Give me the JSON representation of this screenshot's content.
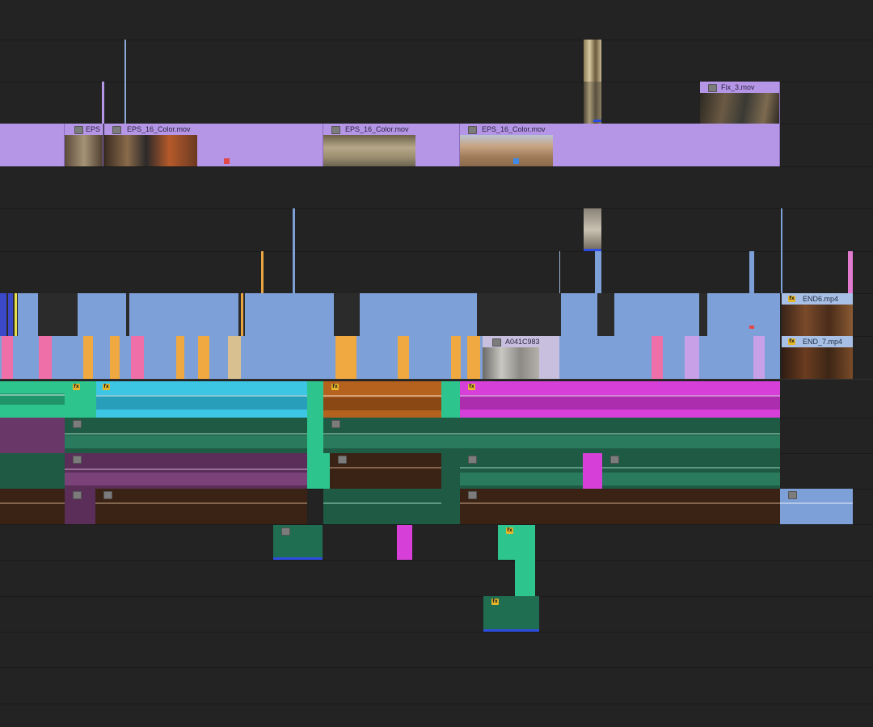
{
  "colors": {
    "background": "#232323",
    "video_clip": "#b596e6",
    "nested_clip": "#7ea0d8",
    "audio_green": "#2ec48e",
    "audio_cyan": "#3cc6e4",
    "audio_orange": "#b5621e",
    "audio_magenta": "#d640d8",
    "audio_purple": "#6a3868",
    "audio_brown": "#3a2214",
    "audio_teal": "#1f5a45",
    "fx_badge": "#e6b62a"
  },
  "clips": {
    "eps_short": "EPS",
    "eps_color_1": "EPS_16_Color.mov",
    "eps_color_2": "EPS_16_Color.mov",
    "eps_color_3": "EPS_16_Color.mov",
    "fix3": "Fix_3.mov",
    "a041": "A041C983",
    "end6": "END6.mp4",
    "end7": "END_7.mp4"
  },
  "icons": {
    "fx_badge": "fx-badge-icon",
    "fx_text": "fx"
  }
}
